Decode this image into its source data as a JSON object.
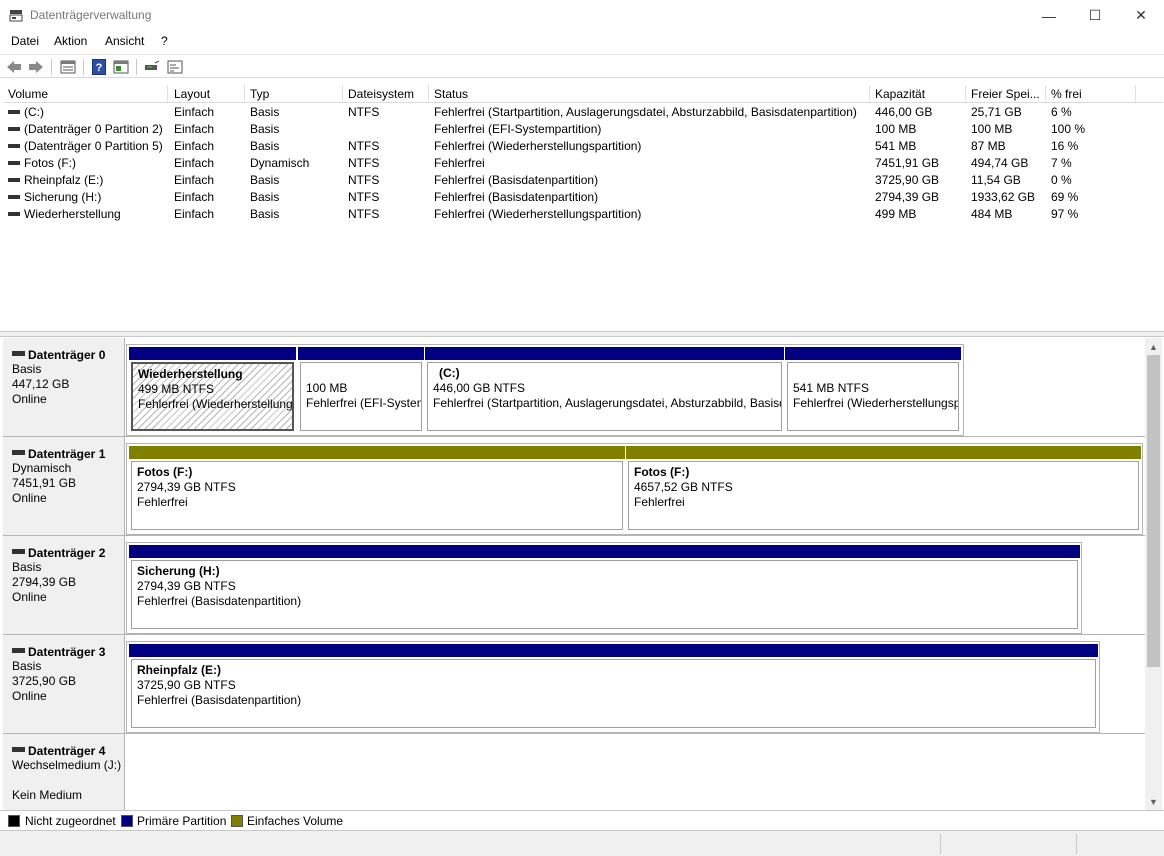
{
  "window": {
    "title": "Datenträgerverwaltung",
    "minimize_glyph": "—",
    "maximize_glyph": "☐",
    "close_glyph": "✕"
  },
  "menu": {
    "items": [
      "Datei",
      "Aktion",
      "Ansicht",
      "?"
    ]
  },
  "toolbar": {
    "icons": [
      "back-arrow-icon",
      "forward-arrow-icon",
      "properties-list-icon",
      "help-icon",
      "refresh-pane-icon",
      "rescan-disks-icon",
      "settings-panel-icon"
    ]
  },
  "volume_table": {
    "columns": [
      "Volume",
      "Layout",
      "Typ",
      "Dateisystem",
      "Status",
      "Kapazität",
      "Freier Spei...",
      "% frei"
    ],
    "rows": [
      [
        "(C:)",
        "Einfach",
        "Basis",
        "NTFS",
        "Fehlerfrei (Startpartition, Auslagerungsdatei, Absturzabbild, Basisdatenpartition)",
        "446,00 GB",
        "25,71 GB",
        "6 %"
      ],
      [
        "(Datenträger 0 Partition 2)",
        "Einfach",
        "Basis",
        "",
        "Fehlerfrei (EFI-Systempartition)",
        "100 MB",
        "100 MB",
        "100 %"
      ],
      [
        "(Datenträger 0 Partition 5)",
        "Einfach",
        "Basis",
        "NTFS",
        "Fehlerfrei (Wiederherstellungspartition)",
        "541 MB",
        "87 MB",
        "16 %"
      ],
      [
        "Fotos (F:)",
        "Einfach",
        "Dynamisch",
        "NTFS",
        "Fehlerfrei",
        "7451,91 GB",
        "494,74 GB",
        "7 %"
      ],
      [
        "Rheinpfalz (E:)",
        "Einfach",
        "Basis",
        "NTFS",
        "Fehlerfrei (Basisdatenpartition)",
        "3725,90 GB",
        "11,54 GB",
        "0 %"
      ],
      [
        "Sicherung (H:)",
        "Einfach",
        "Basis",
        "NTFS",
        "Fehlerfrei (Basisdatenpartition)",
        "2794,39 GB",
        "1933,62 GB",
        "69 %"
      ],
      [
        "Wiederherstellung",
        "Einfach",
        "Basis",
        "NTFS",
        "Fehlerfrei (Wiederherstellungspartition)",
        "499 MB",
        "484 MB",
        "97 %"
      ]
    ]
  },
  "disks": [
    {
      "name": "Datenträger 0",
      "type": "Basis",
      "size": "447,12 GB",
      "state": "Online",
      "partitions": [
        {
          "name": "Wiederherstellung",
          "size": "499 MB NTFS",
          "status": "Fehlerfrei (Wiederherstellungspartition)"
        },
        {
          "name": "",
          "size": "100 MB",
          "status": "Fehlerfrei (EFI-Systempartition)"
        },
        {
          "name": "(C:)",
          "size": "446,00 GB NTFS",
          "status": "Fehlerfrei (Startpartition, Auslagerungsdatei, Absturzabbild, Basisdatenpartition)"
        },
        {
          "name": "",
          "size": "541 MB NTFS",
          "status": "Fehlerfrei (Wiederherstellungspartition)"
        }
      ]
    },
    {
      "name": "Datenträger 1",
      "type": "Dynamisch",
      "size": "7451,91 GB",
      "state": "Online",
      "partitions": [
        {
          "name": "Fotos  (F:)",
          "size": "2794,39 GB NTFS",
          "status": "Fehlerfrei"
        },
        {
          "name": "Fotos  (F:)",
          "size": "4657,52 GB NTFS",
          "status": "Fehlerfrei"
        }
      ]
    },
    {
      "name": "Datenträger 2",
      "type": "Basis",
      "size": "2794,39 GB",
      "state": "Online",
      "partitions": [
        {
          "name": "Sicherung  (H:)",
          "size": "2794,39 GB NTFS",
          "status": "Fehlerfrei (Basisdatenpartition)"
        }
      ]
    },
    {
      "name": "Datenträger 3",
      "type": "Basis",
      "size": "3725,90 GB",
      "state": "Online",
      "partitions": [
        {
          "name": "Rheinpfalz  (E:)",
          "size": "3725,90 GB NTFS",
          "status": "Fehlerfrei (Basisdatenpartition)"
        }
      ]
    },
    {
      "name": "Datenträger 4",
      "type": "Wechselmedium (J:)",
      "size": "",
      "state": "Kein Medium",
      "partitions": []
    }
  ],
  "legend": {
    "items": [
      {
        "label": "Nicht zugeordnet",
        "color": "#000000"
      },
      {
        "label": "Primäre Partition",
        "color": "#000080"
      },
      {
        "label": "Einfaches Volume",
        "color": "#808000"
      }
    ]
  },
  "colors": {
    "primary_partition": "#000080",
    "simple_volume": "#808000",
    "unallocated": "#000000"
  }
}
